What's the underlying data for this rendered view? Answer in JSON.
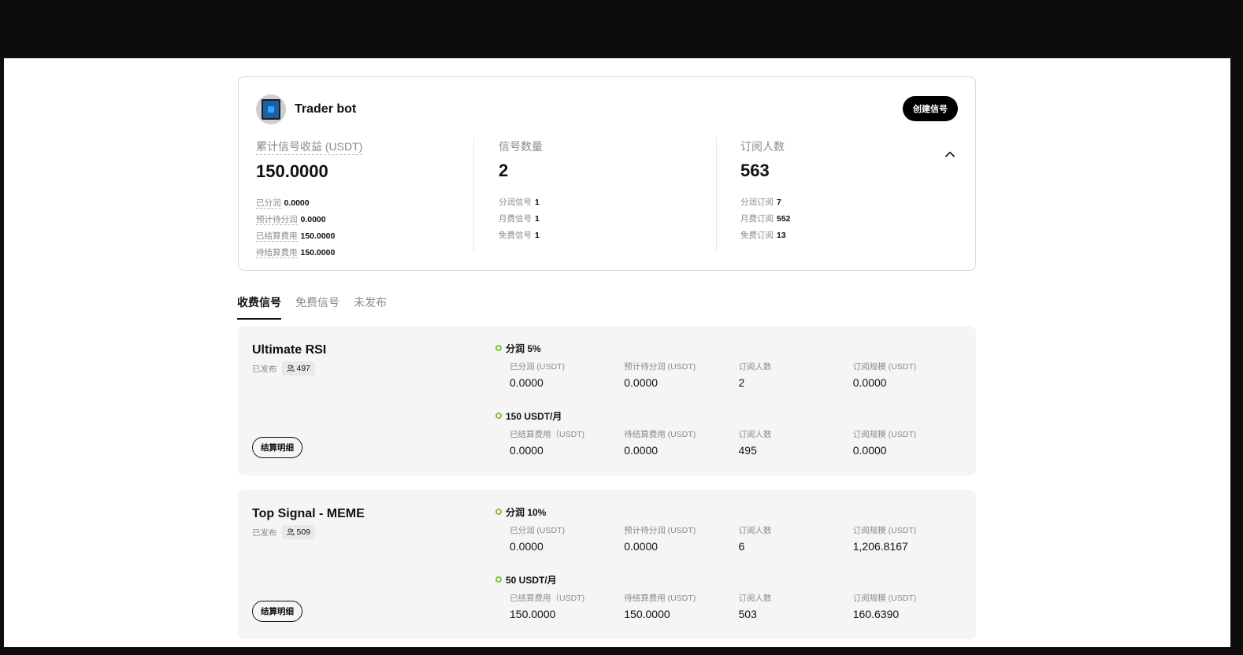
{
  "bot": {
    "name": "Trader bot",
    "create_label": "创建信号"
  },
  "summary": {
    "earnings": {
      "label": "累计信号收益 (USDT)",
      "value": "150.0000",
      "rows": [
        {
          "k": "已分润",
          "v": "0.0000"
        },
        {
          "k": "预计待分润",
          "v": "0.0000"
        },
        {
          "k": "已结算费用",
          "v": "150.0000"
        },
        {
          "k": "待结算费用",
          "v": "150.0000"
        }
      ]
    },
    "signals": {
      "label": "信号数量",
      "value": "2",
      "rows": [
        {
          "k": "分润信号",
          "v": "1"
        },
        {
          "k": "月费信号",
          "v": "1"
        },
        {
          "k": "免费信号",
          "v": "1"
        }
      ]
    },
    "subscribers": {
      "label": "订阅人数",
      "value": "563",
      "rows": [
        {
          "k": "分润订阅",
          "v": "7"
        },
        {
          "k": "月费订阅",
          "v": "552"
        },
        {
          "k": "免费订阅",
          "v": "13"
        }
      ]
    }
  },
  "tabs": [
    {
      "label": "收费信号",
      "active": true
    },
    {
      "label": "免费信号",
      "active": false
    },
    {
      "label": "未发布",
      "active": false
    }
  ],
  "signals": [
    {
      "name": "Ultimate RSI",
      "status": "已发布",
      "count": "497",
      "settle_label": "结算明细",
      "plans": [
        {
          "title": "分润 5%",
          "metrics": [
            {
              "label": "已分润 (USDT)",
              "value": "0.0000"
            },
            {
              "label": "预计待分润 (USDT)",
              "value": "0.0000"
            },
            {
              "label": "订阅人数",
              "value": "2"
            },
            {
              "label": "订阅规模 (USDT)",
              "value": "0.0000"
            }
          ]
        },
        {
          "title": "150 USDT/月",
          "metrics": [
            {
              "label": "已结算费用（USDT)",
              "value": "0.0000"
            },
            {
              "label": "待结算费用 (USDT)",
              "value": "0.0000"
            },
            {
              "label": "订阅人数",
              "value": "495"
            },
            {
              "label": "订阅规模 (USDT)",
              "value": "0.0000"
            }
          ]
        }
      ]
    },
    {
      "name": "Top Signal - MEME",
      "status": "已发布",
      "count": "509",
      "settle_label": "结算明细",
      "plans": [
        {
          "title": "分润 10%",
          "metrics": [
            {
              "label": "已分润 (USDT)",
              "value": "0.0000"
            },
            {
              "label": "预计待分润 (USDT)",
              "value": "0.0000"
            },
            {
              "label": "订阅人数",
              "value": "6"
            },
            {
              "label": "订阅规模 (USDT)",
              "value": "1,206.8167"
            }
          ]
        },
        {
          "title": "50 USDT/月",
          "metrics": [
            {
              "label": "已结算费用（USDT)",
              "value": "150.0000"
            },
            {
              "label": "待结算费用 (USDT)",
              "value": "150.0000"
            },
            {
              "label": "订阅人数",
              "value": "503"
            },
            {
              "label": "订阅规模 (USDT)",
              "value": "160.6390"
            }
          ]
        }
      ]
    }
  ]
}
